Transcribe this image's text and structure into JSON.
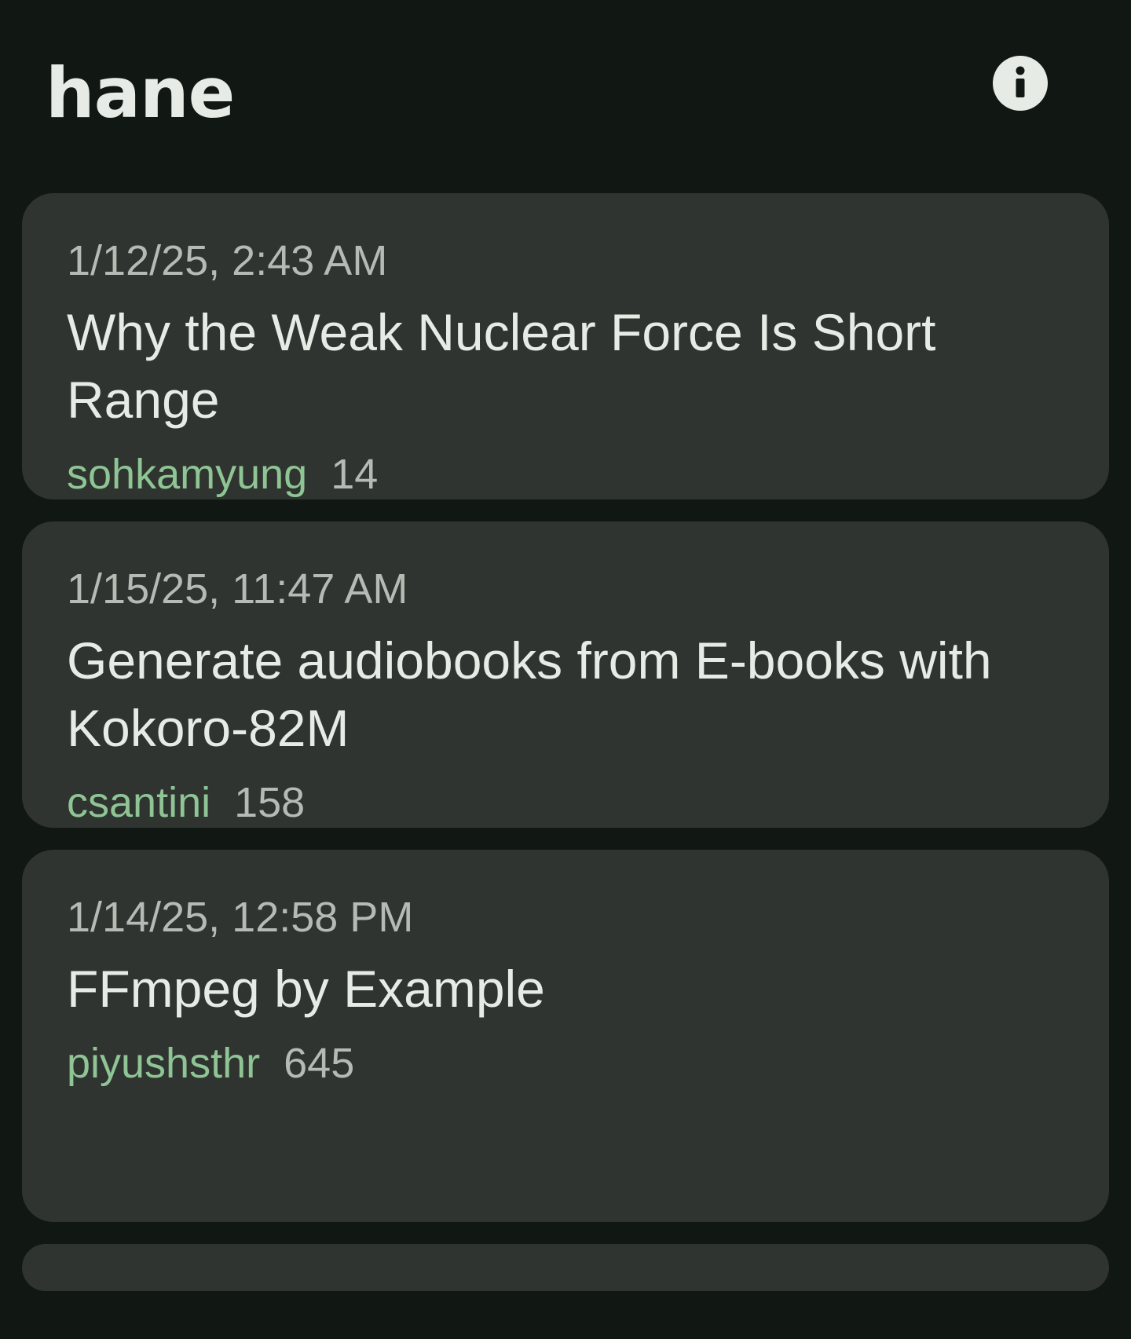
{
  "app": {
    "title": "hane"
  },
  "header": {
    "info_icon": "info-icon"
  },
  "stories": [
    {
      "timestamp": "1/12/25, 2:43 AM",
      "title": "Why the Weak Nuclear Force Is Short Range",
      "author": "sohkamyung",
      "score": "14"
    },
    {
      "timestamp": "1/15/25, 11:47 AM",
      "title": "Generate audiobooks from E-books with Kokoro-82M",
      "author": "csantini",
      "score": "158"
    },
    {
      "timestamp": "1/14/25, 12:58 PM",
      "title": "FFmpeg by Example",
      "author": "piyushsthr",
      "score": "645"
    }
  ],
  "colors": {
    "background": "#111712",
    "card": "#303430",
    "text_primary": "#e6ebe5",
    "text_secondary": "#b5bab4",
    "author_accent": "#8fc495"
  }
}
